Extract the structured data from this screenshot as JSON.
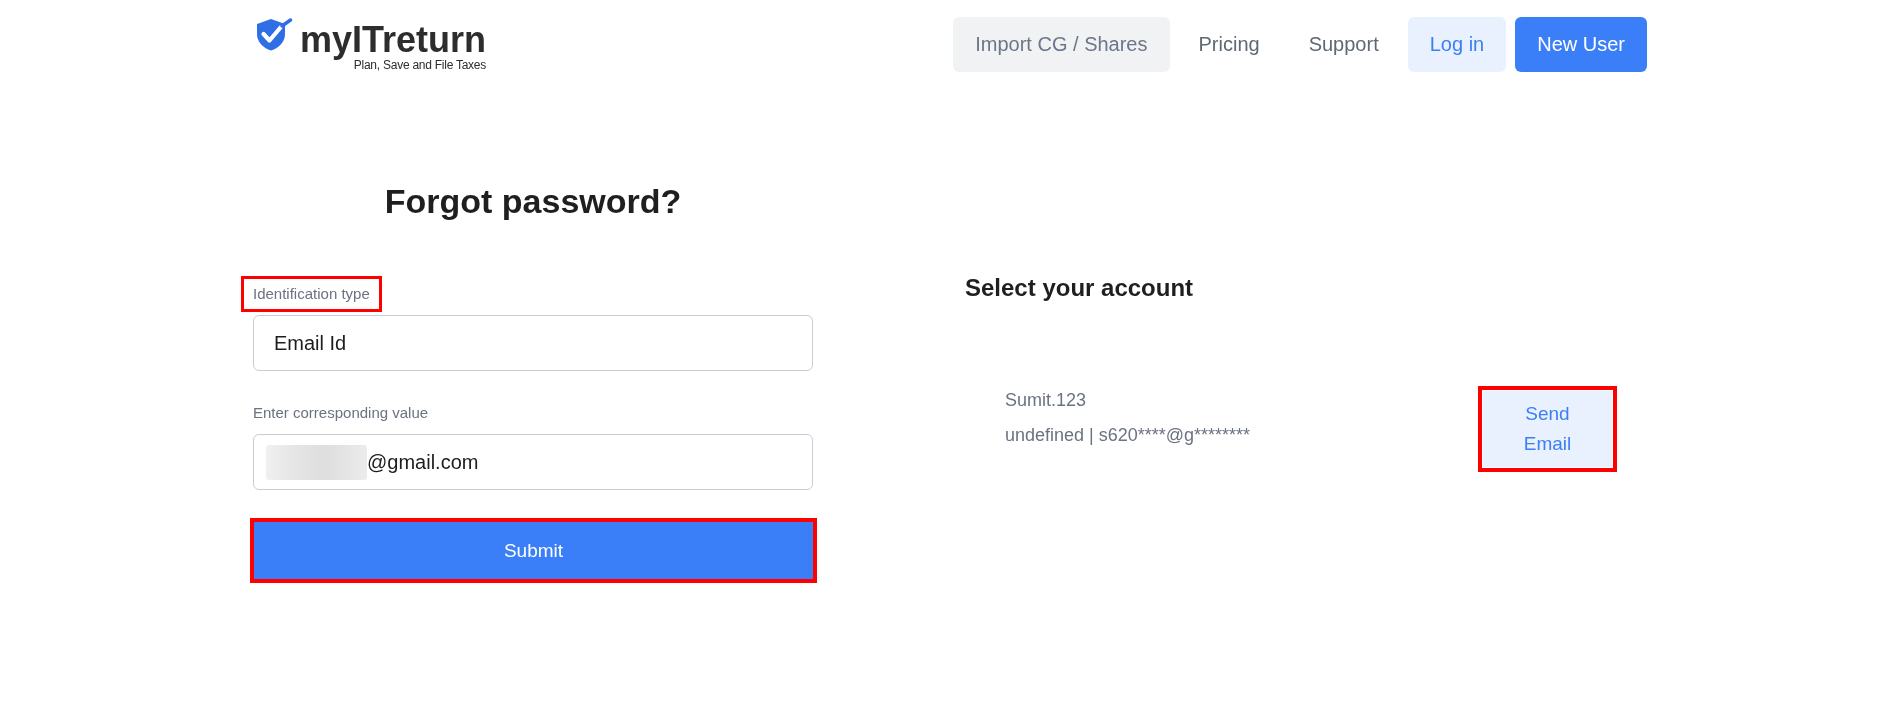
{
  "header": {
    "logo": {
      "wordmark": "myITreturn",
      "tagline": "Plan, Save and File Taxes"
    },
    "nav": [
      {
        "label": "Import CG / Shares",
        "kind": "secondary"
      },
      {
        "label": "Pricing",
        "kind": "link"
      },
      {
        "label": "Support",
        "kind": "link"
      },
      {
        "label": "Log in",
        "kind": "light"
      },
      {
        "label": "New User",
        "kind": "primary"
      }
    ]
  },
  "forgot_password": {
    "title": "Forgot password?",
    "fields": [
      {
        "label": "Identification type",
        "highlighted": true,
        "value": "Email Id",
        "redacted": false
      },
      {
        "label": "Enter corresponding value",
        "highlighted": false,
        "value": "@gmail.com",
        "redacted": true
      }
    ],
    "submit": {
      "label": "Submit",
      "highlighted": true
    }
  },
  "account_selection": {
    "title": "Select your account",
    "accounts": [
      {
        "username": "Sumit.123",
        "details": "undefined | s620****@g********",
        "action": {
          "label": "Send Email",
          "highlighted": true
        }
      }
    ]
  }
}
